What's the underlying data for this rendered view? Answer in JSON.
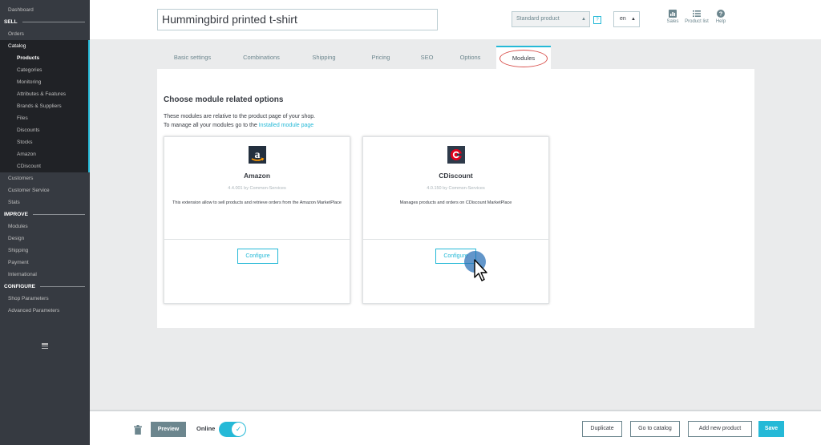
{
  "sidebar": {
    "dashboard": "Dashboard",
    "sell_section": "SELL",
    "orders": "Orders",
    "catalog": "Catalog",
    "catalog_items": [
      "Products",
      "Categories",
      "Monitoring",
      "Attributes & Features",
      "Brands & Suppliers",
      "Files",
      "Discounts",
      "Stocks",
      "Amazon",
      "CDiscount"
    ],
    "customers": "Customers",
    "customer_service": "Customer Service",
    "stats": "Stats",
    "improve_section": "IMPROVE",
    "improve_items": [
      "Modules",
      "Design",
      "Shipping",
      "Payment",
      "International"
    ],
    "configure_section": "CONFIGURE",
    "configure_items": [
      "Shop Parameters",
      "Advanced Parameters"
    ]
  },
  "header": {
    "product_name": "Hummingbird printed t-shirt",
    "product_type": "Standard product",
    "language": "en",
    "tools": [
      "Sales",
      "Product list",
      "Help"
    ]
  },
  "tabs": [
    "Basic settings",
    "Combinations",
    "Shipping",
    "Pricing",
    "SEO",
    "Options",
    "Modules"
  ],
  "active_tab": "Modules",
  "main": {
    "heading": "Choose module related options",
    "desc_line1": "These modules are relative to the product page of your shop.",
    "desc_line2_prefix": "To manage all your modules go to the ",
    "desc_link": "Installed module page",
    "modules": [
      {
        "name": "Amazon",
        "version": "4.4.001 by Common-Services",
        "description": "This extension allow to sell products and retrieve orders from the Amazon MarketPlace",
        "button": "Configure"
      },
      {
        "name": "CDiscount",
        "version": "4.0.150 by Common-Services",
        "description": "Manages products and orders on CDiscount MarketPlace",
        "button": "Configure"
      }
    ]
  },
  "footer": {
    "preview": "Preview",
    "online": "Online",
    "duplicate": "Duplicate",
    "go_to_catalog": "Go to catalog",
    "add_new_product": "Add new product",
    "save": "Save"
  },
  "colors": {
    "accent": "#25b9d7",
    "sidebar_bg": "#363a41",
    "highlight_circle": "#d9534f"
  }
}
